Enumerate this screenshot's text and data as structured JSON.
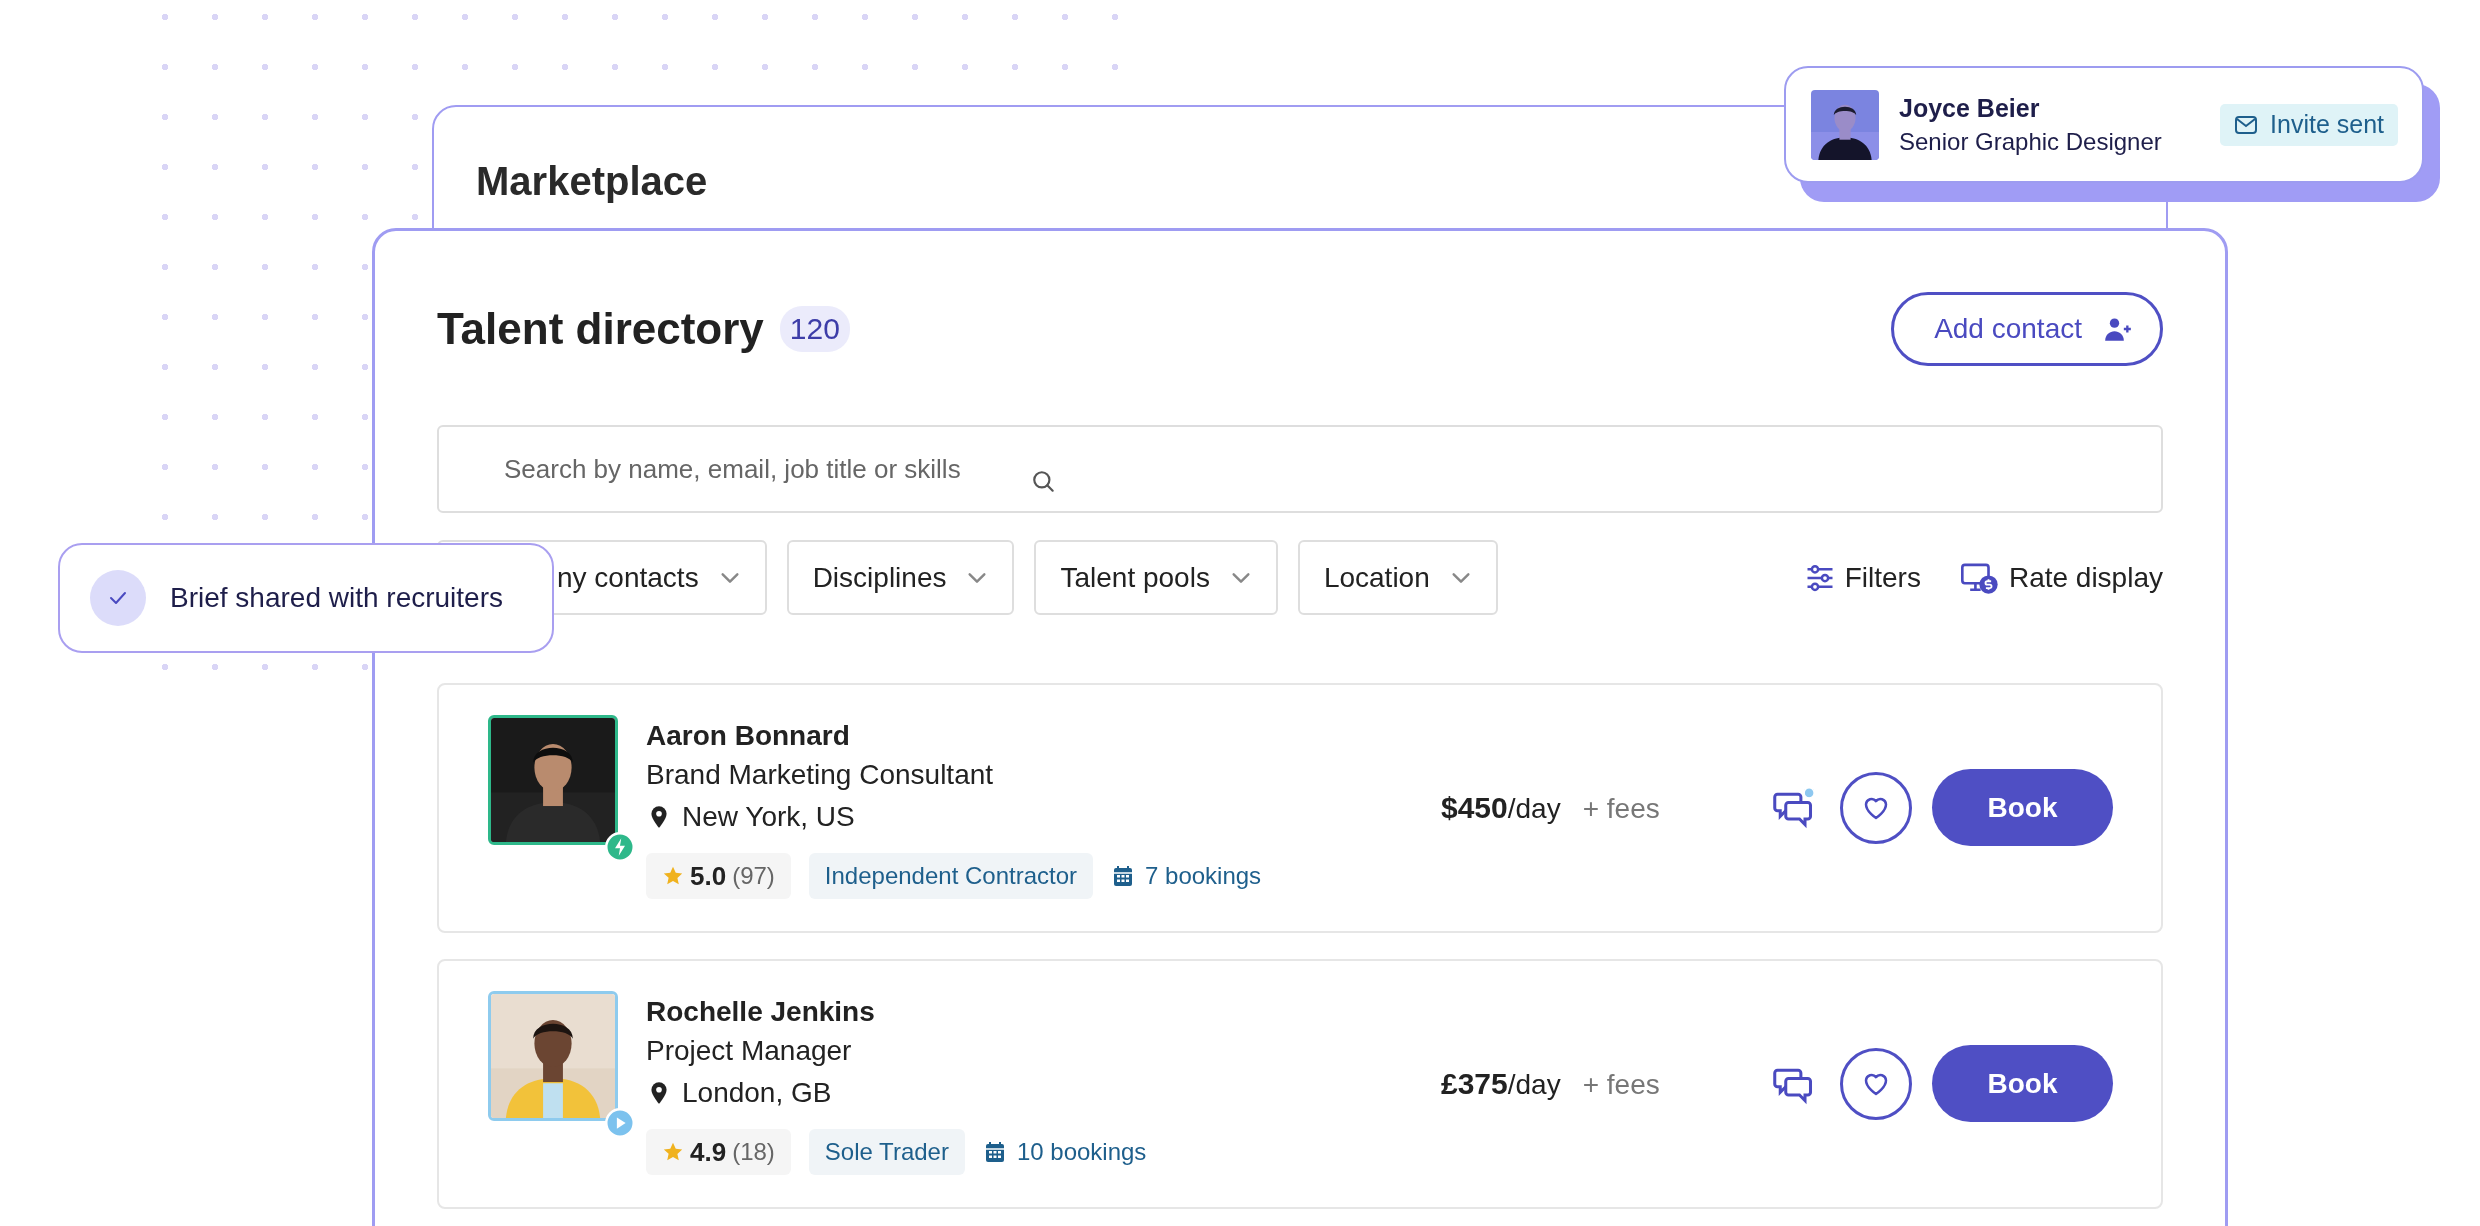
{
  "back_panel": {
    "title": "Marketplace"
  },
  "profile_card": {
    "name": "Joyce Beier",
    "title": "Senior Graphic Designer",
    "status": "Invite sent"
  },
  "toast": {
    "text": "Brief shared with recruiters"
  },
  "directory": {
    "title": "Talent directory",
    "count": "120",
    "add_button": "Add contact",
    "search": {
      "placeholder": "Search by name, email, job title or skills"
    },
    "filters": [
      {
        "label": "ny contacts"
      },
      {
        "label": "Disciplines"
      },
      {
        "label": "Talent pools"
      },
      {
        "label": "Location"
      }
    ],
    "actions": [
      {
        "kind": "filters",
        "label": "Filters"
      },
      {
        "kind": "rate",
        "label": "Rate display"
      }
    ],
    "rows": [
      {
        "name": "Aaron Bonnard",
        "title": "Brand Marketing Consultant",
        "location": "New York, US",
        "kind": "bolt",
        "rating": "5.0",
        "reviews": "(97)",
        "type": "Independent Contractor",
        "bookings": "7 bookings",
        "price": "$450",
        "unit": "/day",
        "fees": "+ fees",
        "unread": true,
        "button": "Book"
      },
      {
        "name": "Rochelle Jenkins",
        "title": "Project Manager",
        "location": "London, GB",
        "kind": "play",
        "rating": "4.9",
        "reviews": "(18)",
        "type": "Sole Trader",
        "bookings": "10 bookings",
        "price": "£375",
        "unit": "/day",
        "fees": "+ fees",
        "unread": false,
        "button": "Book"
      }
    ]
  }
}
